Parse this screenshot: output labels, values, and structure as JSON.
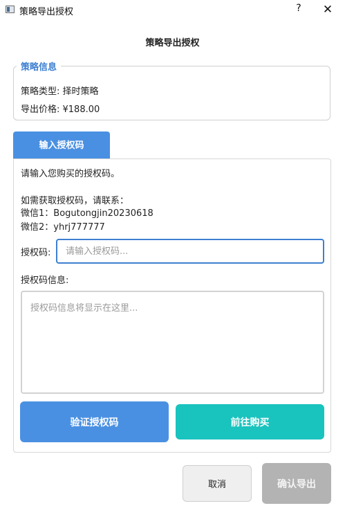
{
  "window": {
    "title": "策略导出授权",
    "help_glyph": "?",
    "close_glyph": "✕"
  },
  "dialog": {
    "heading": "策略导出授权"
  },
  "strategy_info": {
    "legend": "策略信息",
    "type_line": "策略类型: 择时策略",
    "price_line": "导出价格: ¥188.00"
  },
  "tab": {
    "label": "输入授权码"
  },
  "instructions": {
    "prompt": "请输入您购买的授权码。",
    "contact_intro": "如需获取授权码，请联系：",
    "wechat1": "微信1：Bogutongjin20230618",
    "wechat2": "微信2：yhrj777777"
  },
  "auth_code": {
    "label": "授权码:",
    "value": "",
    "placeholder": "请输入授权码..."
  },
  "auth_info": {
    "label": "授权码信息:",
    "value": "",
    "placeholder": "授权码信息将显示在这里..."
  },
  "buttons": {
    "verify": "验证授权码",
    "buy": "前往购买",
    "cancel": "取消",
    "confirm": "确认导出"
  },
  "colors": {
    "accent": "#4a90e2",
    "teal": "#19c3be",
    "disabled": "#b3b3b3"
  }
}
